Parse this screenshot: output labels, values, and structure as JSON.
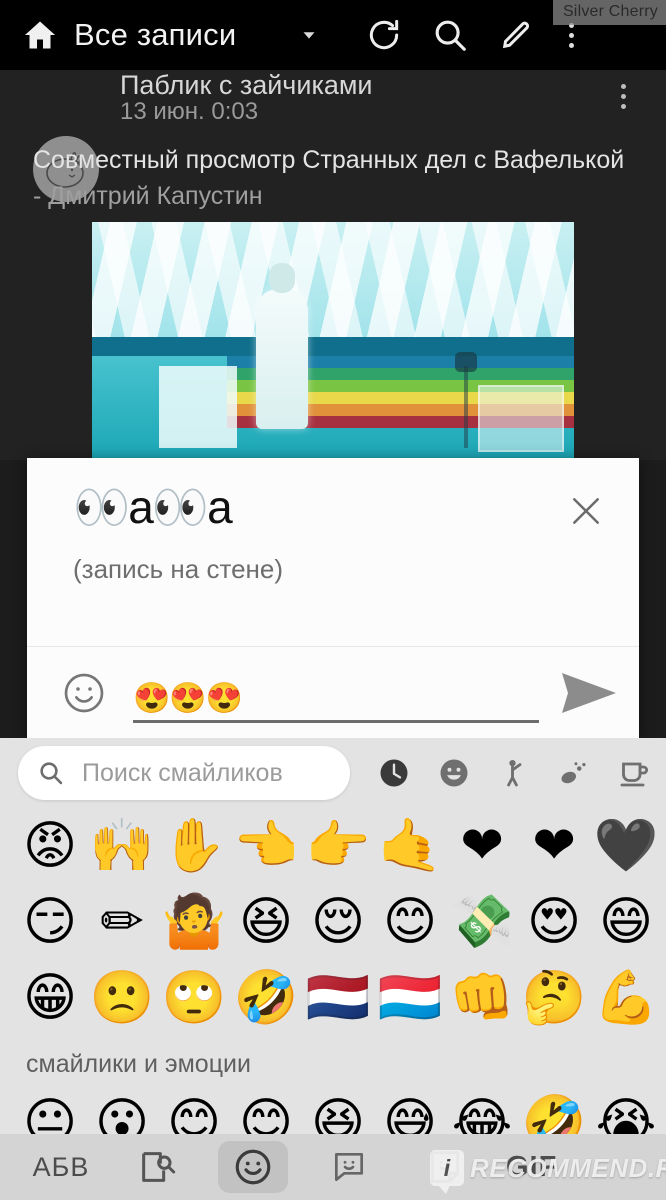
{
  "app": {
    "title": "Все записи",
    "watermark_top": "Silver Cherry"
  },
  "appbar": {
    "home_icon": "home-icon",
    "caret_icon": "chevron-down-icon",
    "refresh_icon": "refresh-icon",
    "search_icon": "search-icon",
    "compose_icon": "pencil-icon",
    "overflow_icon": "overflow-menu-icon"
  },
  "post": {
    "author": "Паблик с зайчиками",
    "date": "13 июн. 0:03",
    "text_line1": "Совместный просмотр Странных дел с Вафелькой",
    "text_line2": "- Дмитрий Капустин",
    "avatar_icon": "bunny-avatar-icon",
    "menu_icon": "overflow-menu-icon",
    "media_alt": "video-thumbnail"
  },
  "dialog": {
    "title": "👀a👀a",
    "subtitle": "(запись на стене)",
    "close_icon": "close-icon",
    "composer": {
      "emoji_button_icon": "smiley-outline-icon",
      "value": "😍😍😍",
      "placeholder": "",
      "send_icon": "send-icon"
    }
  },
  "keyboard": {
    "search": {
      "icon": "search-icon",
      "placeholder": "Поиск смайликов",
      "value": ""
    },
    "categories": [
      {
        "name": "recent",
        "glyph": "🕐",
        "active": true
      },
      {
        "name": "smileys",
        "glyph": "☺",
        "active": false
      },
      {
        "name": "people",
        "glyph": "🙋",
        "active": false
      },
      {
        "name": "nature",
        "glyph": "🌿",
        "active": false
      },
      {
        "name": "food",
        "glyph": "☕",
        "active": false
      },
      {
        "name": "activity",
        "glyph": "⚑",
        "active": false
      }
    ],
    "rows": [
      [
        "😡",
        "🙌",
        "✋",
        "👈",
        "👉",
        "🤙",
        "❤",
        "❤",
        "🖤"
      ],
      [
        "😏",
        "✏",
        "🤷",
        "😆",
        "😌",
        "😊",
        "💸",
        "😍",
        "😄"
      ],
      [
        "😁",
        "🙁",
        "🙄",
        "🤣",
        "🇳🇱",
        "🇱🇺",
        "👊",
        "🤔",
        "💪"
      ]
    ],
    "section_label": "смайлики и эмоции",
    "partial_row": [
      "😐",
      "😮",
      "😊",
      "😊",
      "😆",
      "😅",
      "😂",
      "🤣",
      "😭"
    ],
    "bottom_bar": {
      "abc_label": "АБВ",
      "image_search_icon": "image-search-icon",
      "emoji_icon": "smiley-icon",
      "sticker_icon": "sticker-smiley-icon",
      "sticker2_icon": "sticker-note-icon",
      "gif_label": "GIF"
    }
  },
  "watermark_bottom": {
    "badge": "i",
    "text": "RECOMMEND.RU"
  },
  "colors": {
    "appbar_bg": "#000000",
    "feed_bg": "#222222",
    "dialog_bg": "#fcfcfc",
    "keyboard_bg": "#e3e3e3",
    "kb_bottom_bg": "#d4d4d4"
  }
}
